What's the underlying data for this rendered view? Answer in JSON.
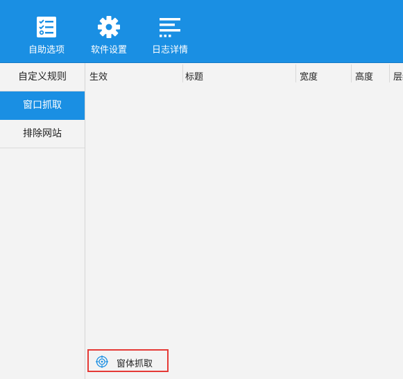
{
  "toolbar": {
    "buttons": [
      {
        "label": "自助选项",
        "icon": "checklist-icon"
      },
      {
        "label": "软件设置",
        "icon": "gear-icon"
      },
      {
        "label": "日志详情",
        "icon": "log-lines-icon"
      }
    ]
  },
  "sidebar": {
    "items": [
      {
        "label": "自定义规则",
        "active": false
      },
      {
        "label": "窗口抓取",
        "active": true
      },
      {
        "label": "排除网站",
        "active": false
      }
    ]
  },
  "table": {
    "columns": [
      "生效",
      "标题",
      "宽度",
      "高度",
      "层级"
    ],
    "rows": []
  },
  "capture_button": {
    "label": "窗体抓取",
    "icon": "crosshair-target-icon"
  },
  "colors": {
    "accent": "#1a8fe3",
    "highlight_border": "#e53935"
  }
}
